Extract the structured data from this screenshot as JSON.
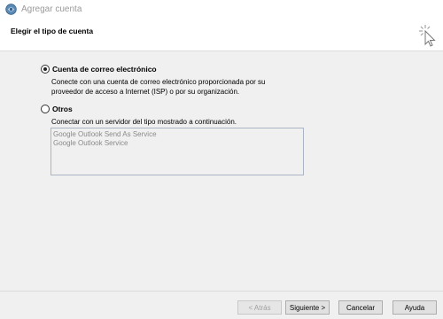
{
  "window": {
    "title": "Agregar cuenta"
  },
  "header": {
    "title": "Elegir el tipo de cuenta"
  },
  "options": {
    "email": {
      "label": "Cuenta de correo electrónico",
      "desc_line1": "Conecte con una cuenta de correo electrónico proporcionada por su",
      "desc_line2": "proveedor de acceso a Internet (ISP) o por su organización.",
      "checked": true
    },
    "other": {
      "label": "Otros",
      "desc": "Conectar con un servidor del tipo mostrado a continuación.",
      "checked": false
    }
  },
  "server_list": {
    "items": [
      "Google Outlook Send As Service",
      "Google Outlook Service"
    ]
  },
  "buttons": {
    "back": "< Atrás",
    "next": "Siguiente >",
    "cancel": "Cancelar",
    "help": "Ayuda"
  }
}
